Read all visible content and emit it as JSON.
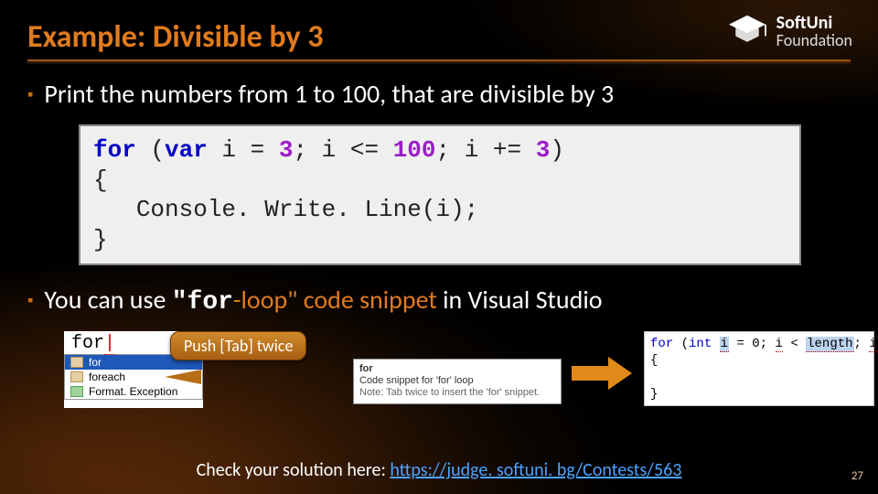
{
  "brand": {
    "line1": "SoftUni",
    "line2": "Foundation"
  },
  "title": "Example: Divisible by 3",
  "bullets": {
    "b1": "Print the numbers from 1 to 100, that are divisible by 3",
    "b2_prefix": "You can use ",
    "b2_code": "\"for",
    "b2_suffix": "-loop\" code snippet",
    "b2_tail": " in Visual Studio"
  },
  "code": {
    "kw_for": "for",
    "kw_var": "var",
    "n3a": "3",
    "n100": "100",
    "n3b": "3",
    "body": "Console. Write. Line(i);"
  },
  "tip": {
    "label": "Push [Tab] twice"
  },
  "intellisense": {
    "typed": "for",
    "items": [
      "for",
      "foreach",
      "Format. Exception"
    ],
    "tooltip": {
      "l1": "for",
      "l2": "Code snippet for 'for' loop",
      "l3": "Note: Tab twice to insert the 'for' snippet."
    }
  },
  "expanded": {
    "kw_for": "for",
    "ty_int": "int",
    "var_i": "i",
    "zero": "0",
    "lt": "<",
    "len": "length",
    "inc": "i++"
  },
  "footer": {
    "prefix": "Check your solution here: ",
    "url": "https://judge. softuni. bg/Contests/563"
  },
  "page": "27"
}
